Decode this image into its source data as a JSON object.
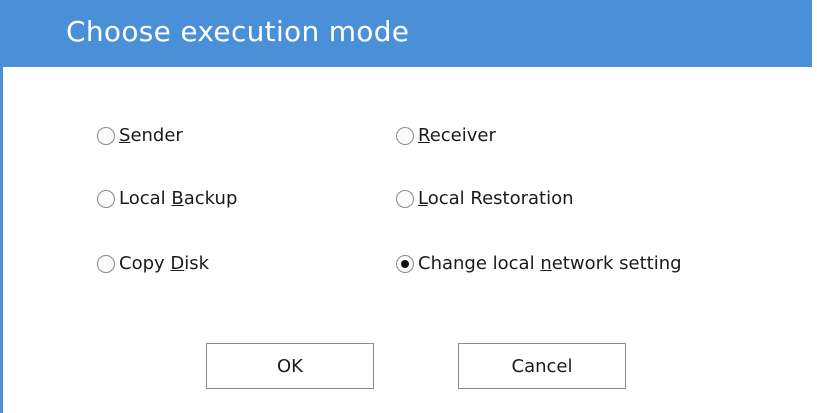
{
  "dialog": {
    "title": "Choose execution mode"
  },
  "options": [
    {
      "id": "sender",
      "pre": "",
      "key": "S",
      "post": "ender",
      "checked": false
    },
    {
      "id": "receiver",
      "pre": "",
      "key": "R",
      "post": "eceiver",
      "checked": false
    },
    {
      "id": "local-backup",
      "pre": "Local ",
      "key": "B",
      "post": "ackup",
      "checked": false
    },
    {
      "id": "local-restoration",
      "pre": "",
      "key": "L",
      "post": "ocal Restoration",
      "checked": false
    },
    {
      "id": "copy-disk",
      "pre": "Copy ",
      "key": "D",
      "post": "isk",
      "checked": false
    },
    {
      "id": "change-network",
      "pre": "Change local ",
      "key": "n",
      "post": "etwork setting",
      "checked": true
    }
  ],
  "buttons": {
    "ok_label": "OK",
    "cancel_label": "Cancel"
  },
  "colors": {
    "accent": "#4a90d9"
  }
}
